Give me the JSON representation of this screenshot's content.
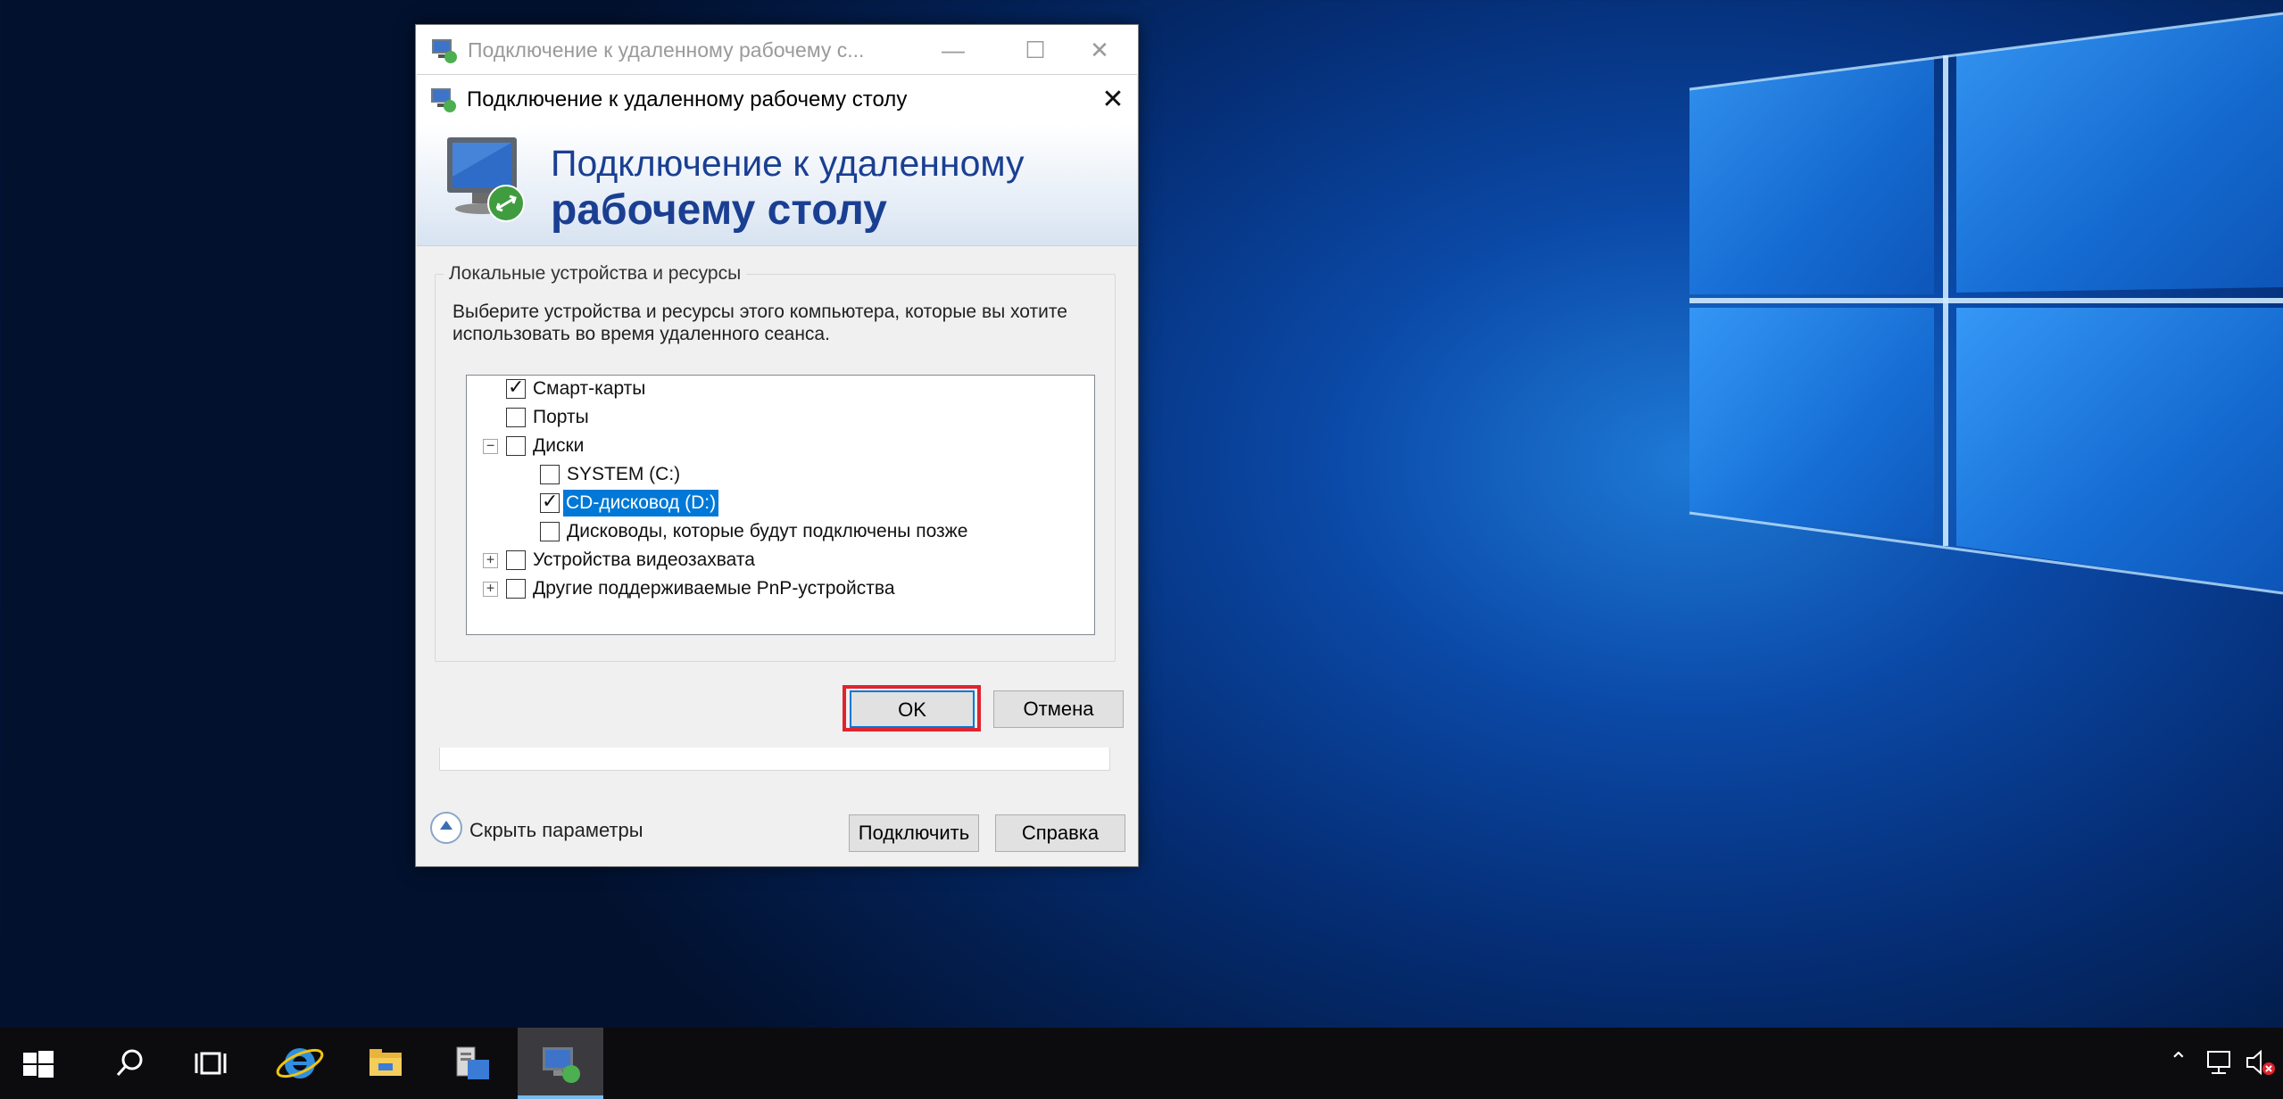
{
  "main_window": {
    "title": "Подключение к удаленному рабочему с...",
    "hide_options_label": "Скрыть параметры",
    "connect_label": "Подключить",
    "help_label": "Справка"
  },
  "dialog": {
    "title": "Подключение к удаленному рабочему столу",
    "banner_line1": "Подключение к удаленному",
    "banner_line2": "рабочему столу",
    "group_label": "Локальные устройства и ресурсы",
    "description": "Выберите устройства и ресурсы этого компьютера, которые вы хотите использовать во время удаленного сеанса.",
    "tree": [
      {
        "label": "Смарт-карты",
        "checked": true
      },
      {
        "label": "Порты",
        "checked": false
      },
      {
        "label": "Диски",
        "checked": false,
        "expander": "−"
      },
      {
        "label": "SYSTEM (C:)",
        "checked": false
      },
      {
        "label": "CD-дисковод (D:)",
        "checked": true,
        "selected": true
      },
      {
        "label": "Дисководы, которые будут подключены позже",
        "checked": false
      },
      {
        "label": "Устройства видеозахвата",
        "checked": false,
        "expander": "+"
      },
      {
        "label": "Другие поддерживаемые PnP-устройства",
        "checked": false,
        "expander": "+"
      }
    ],
    "ok_label": "OK",
    "cancel_label": "Отмена"
  },
  "taskbar": {
    "items": [
      "start-icon",
      "search-icon",
      "task-view-icon",
      "internet-explorer-icon",
      "file-explorer-icon",
      "server-manager-icon",
      "remote-desktop-icon"
    ],
    "active": "remote-desktop-icon"
  },
  "colors": {
    "accent": "#0078d7",
    "highlight_box": "#e0242e",
    "banner_text": "#1a3f92"
  }
}
